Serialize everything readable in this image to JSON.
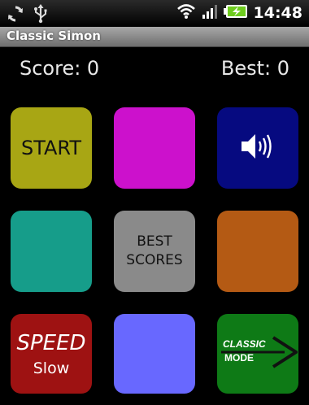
{
  "status_bar": {
    "time": "14:48",
    "icons": [
      "sync-icon",
      "usb-icon",
      "wifi-icon",
      "signal-icon",
      "battery-charging-icon"
    ]
  },
  "app": {
    "title": "Classic Simon"
  },
  "scores": {
    "score_text": "Score: 0",
    "best_text": "Best: 0"
  },
  "tiles": {
    "start": {
      "label": "START",
      "color": "#a8a614"
    },
    "magenta": {
      "color": "#cc11cc"
    },
    "sound": {
      "icon": "speaker-icon",
      "color": "#060a80"
    },
    "teal": {
      "color": "#169d8a"
    },
    "best_scores": {
      "line1": "BEST",
      "line2": "SCORES",
      "color": "#8a8a8a"
    },
    "orange": {
      "color": "#b45a14"
    },
    "speed": {
      "title": "SPEED",
      "value": "Slow",
      "color": "#9e1212"
    },
    "blue": {
      "color": "#6868ff"
    },
    "mode": {
      "line1": "CLASSIC",
      "line2": "MODE",
      "icon": "arrow-right-icon",
      "color": "#0e7a16"
    }
  }
}
